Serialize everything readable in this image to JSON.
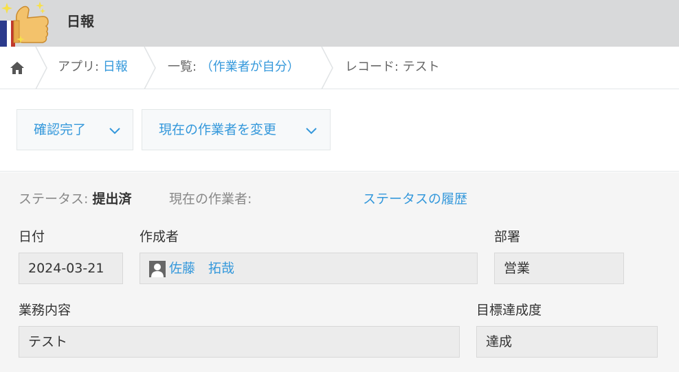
{
  "header": {
    "app_title": "日報",
    "app_icon": "thumbs-up-icon"
  },
  "breadcrumb": {
    "home_icon": "home-icon",
    "app_prefix": "アプリ: ",
    "app_name": "日報",
    "list_prefix": "一覧: ",
    "list_name": "（作業者が自分）",
    "record_label": "レコード: テスト"
  },
  "actions": {
    "confirm_button": "確認完了",
    "change_assignee_button": "現在の作業者を変更"
  },
  "status_bar": {
    "status_label": "ステータス: ",
    "status_value": "提出済",
    "assignee_label": "現在の作業者:",
    "history_link": "ステータスの履歴"
  },
  "fields": {
    "date": {
      "label": "日付",
      "value": "2024-03-21"
    },
    "creator": {
      "label": "作成者",
      "value": "佐藤　拓哉"
    },
    "department": {
      "label": "部署",
      "value": "営業"
    },
    "work_content": {
      "label": "業務内容",
      "value": "テスト"
    },
    "goal_achievement": {
      "label": "目標達成度",
      "value": "達成"
    }
  },
  "colors": {
    "accent": "#3498db",
    "header_bg": "#d8d9da",
    "record_bg": "#f5f5f5"
  }
}
